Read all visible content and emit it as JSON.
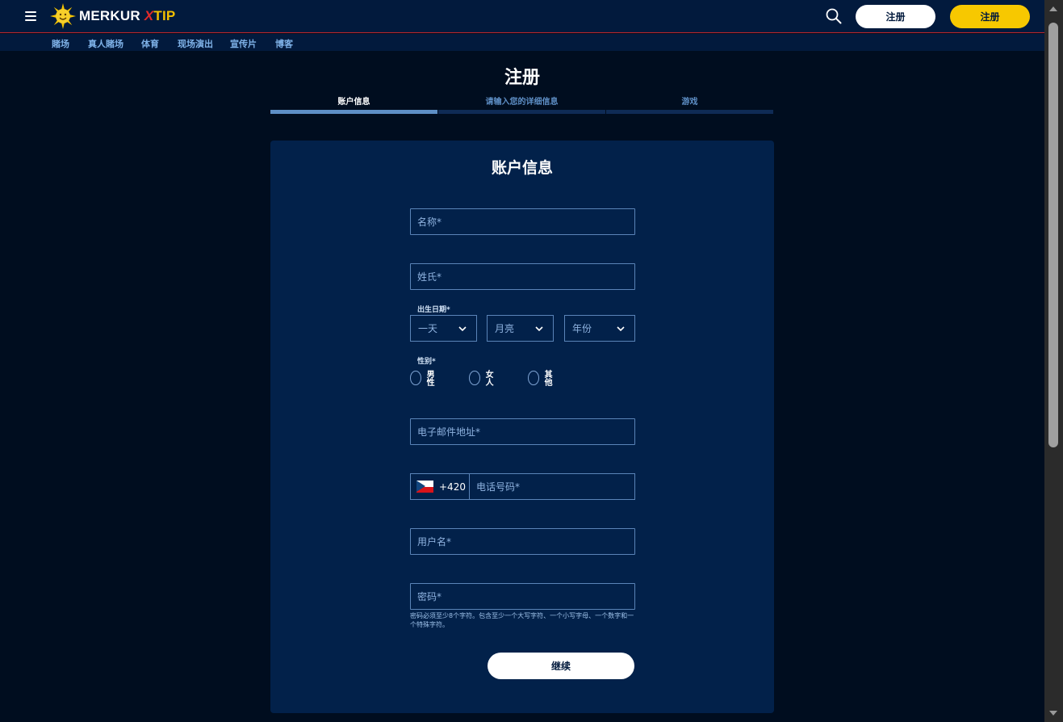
{
  "header": {
    "logo": {
      "merkur": "MERKUR",
      "x": "X",
      "tip": "TIP"
    },
    "login_label": "注册",
    "register_label": "注册"
  },
  "subnav": {
    "items": [
      "賭场",
      "真人賭场",
      "体育",
      "现场演出",
      "宣传片",
      "博客"
    ]
  },
  "page": {
    "title": "注册",
    "steps": [
      {
        "label": "账户信息",
        "active": true
      },
      {
        "label": "请输入您的详细信息",
        "active": false
      },
      {
        "label": "游戏",
        "active": false
      }
    ]
  },
  "form": {
    "title": "账户信息",
    "first_name_placeholder": "名称*",
    "last_name_placeholder": "姓氏*",
    "dob_label": "出生日期*",
    "dob_day": "一天",
    "dob_month": "月亮",
    "dob_year": "年份",
    "gender_label": "性别*",
    "gender_options": [
      "男性",
      "女人",
      "其他"
    ],
    "email_placeholder": "电子邮件地址*",
    "phone_code": "+420",
    "phone_placeholder": "电话号码*",
    "username_placeholder": "用户名*",
    "password_placeholder": "密码*",
    "password_hint": "密码必须至少8个字符。包含至少一个大写字符、一个小写字母、一个数字和一个特殊字符。",
    "continue_label": "继续"
  },
  "colors": {
    "page_bg": "#000d1f",
    "header_bg": "#021a3d",
    "card_bg": "#02214a",
    "accent_yellow": "#f7c800",
    "header_border": "#c0262d",
    "step_active": "#5e8fc6"
  }
}
